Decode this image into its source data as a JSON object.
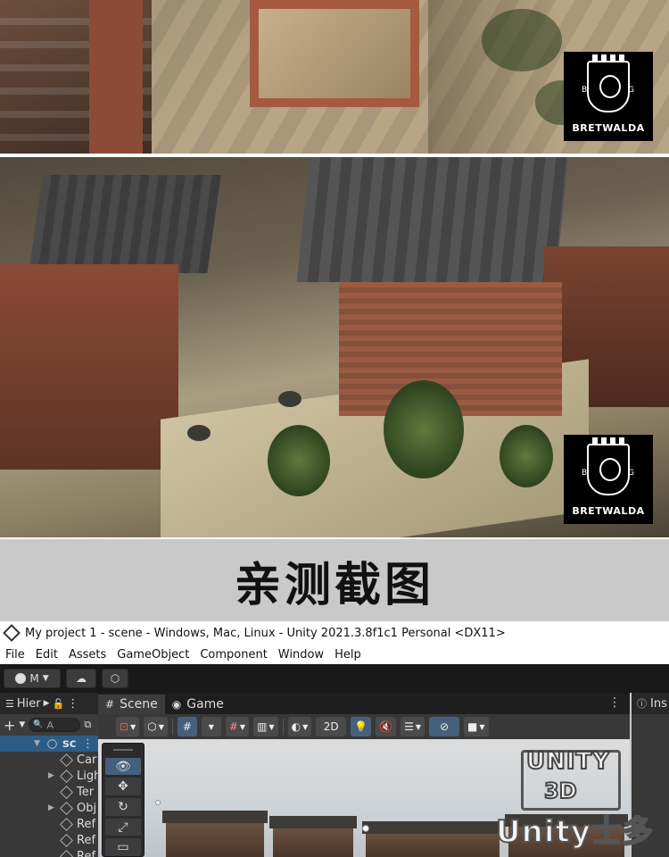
{
  "promo": {
    "logo_text": "BRETWALDA",
    "logo_letters": [
      "B",
      "G"
    ]
  },
  "caption": "亲测截图",
  "unity": {
    "window_title": "My project 1 - scene - Windows, Mac, Linux - Unity 2021.3.8f1c1 Personal <DX11>",
    "menu": [
      "File",
      "Edit",
      "Assets",
      "GameObject",
      "Component",
      "Window",
      "Help"
    ],
    "account_label": "M",
    "hierarchy": {
      "tab_label": "Hier",
      "search_placeholder": "A",
      "rows": [
        {
          "label": "sc"
        },
        {
          "label": "Car"
        },
        {
          "label": "Ligh"
        },
        {
          "label": "Ter"
        },
        {
          "label": "Obj"
        },
        {
          "label": "Ref"
        },
        {
          "label": "Ref"
        },
        {
          "label": "Ref"
        }
      ]
    },
    "scene_tabs": [
      {
        "label": "Scene",
        "icon": "grid-icon"
      },
      {
        "label": "Game",
        "icon": "gamepad-icon"
      }
    ],
    "scene_toolbar": {
      "mode_2d": "2D"
    },
    "inspector_tab": "Ins"
  },
  "watermark": {
    "brand": "UNITY",
    "sub": "3D",
    "site": "Unity士多"
  },
  "colors": {
    "selection": "#2c5d87",
    "active_tool": "#46607c",
    "editor_dark": "#383838"
  }
}
